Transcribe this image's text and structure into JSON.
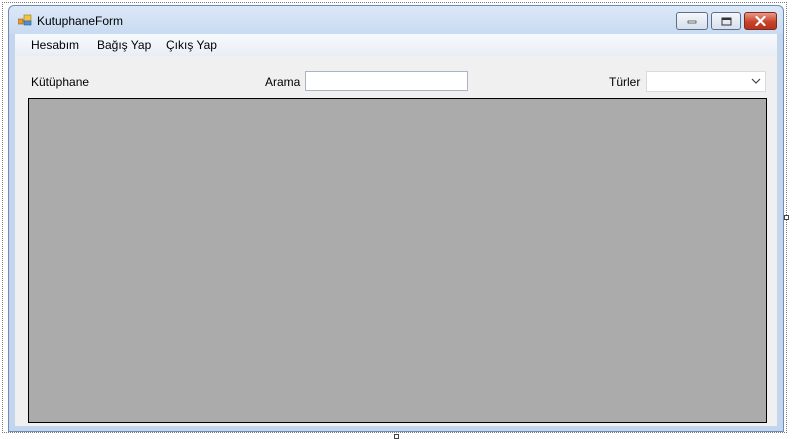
{
  "window": {
    "title": "KutuphaneForm",
    "icon": "form-icon",
    "caption_buttons": [
      "minimize-icon",
      "maximize-icon",
      "close-icon"
    ]
  },
  "menu": {
    "items": [
      {
        "label": "Hesabım"
      },
      {
        "label": "Bağış Yap"
      },
      {
        "label": "Çıkış Yap"
      }
    ]
  },
  "toolbar": {
    "library_label": "Kütüphane",
    "search_label": "Arama",
    "search_value": "",
    "genres_label": "Türler",
    "genres_selected": ""
  },
  "grid": {
    "background": "#ababab",
    "rows": []
  }
}
